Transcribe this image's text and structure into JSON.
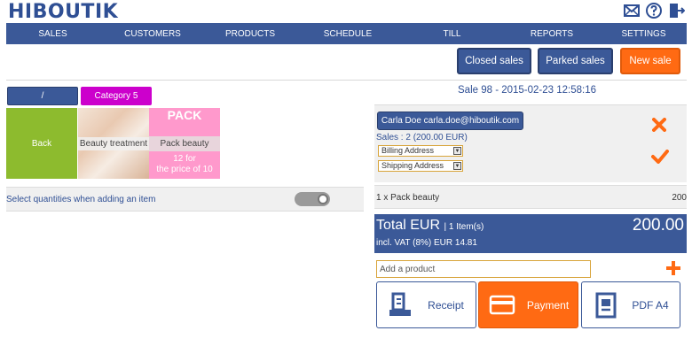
{
  "app": {
    "logo": "HIBOUTIK"
  },
  "header_icons": [
    "mail-icon",
    "help-icon",
    "logout-icon"
  ],
  "nav": [
    "SALES",
    "CUSTOMERS",
    "PRODUCTS",
    "SCHEDULE",
    "TILL",
    "REPORTS",
    "SETTINGS"
  ],
  "actions": {
    "closed_sales": "Closed sales",
    "parked_sales": "Parked sales",
    "new_sale": "New sale"
  },
  "categories": {
    "root": "/",
    "current": "Category 5"
  },
  "tiles": {
    "back": "Back",
    "beauty": "Beauty treatment",
    "pack_title": "PACK",
    "pack_label": "Pack beauty",
    "pack_desc_1": "12 for",
    "pack_desc_2": "the price of 10"
  },
  "quantity_option": {
    "label": "Select quantities when adding an item",
    "enabled": false
  },
  "sale": {
    "title": "Sale   98 - 2015-02-23 12:58:16",
    "customer": "Carla Doe carla.doe@hiboutik.com",
    "sales_count": "Sales : 2 (200.00 EUR)",
    "billing": "Billing Address",
    "shipping": "Shipping Address"
  },
  "lines": [
    {
      "desc": "1 x Pack beauty",
      "amount": "200"
    }
  ],
  "total": {
    "label": "Total EUR",
    "items": "| 1 Item(s)",
    "amount": "200.00",
    "vat": "incl. VAT (8%) EUR 14.81"
  },
  "add_product": {
    "placeholder": "Add a product"
  },
  "bottom_buttons": {
    "receipt": "Receipt",
    "payment": "Payment",
    "pdf": "PDF A4"
  },
  "colors": {
    "brand": "#3b5998",
    "accent": "#ff6a13",
    "green": "#8dbb2e",
    "pink": "#ff99cc",
    "category": "#cc00cc"
  }
}
